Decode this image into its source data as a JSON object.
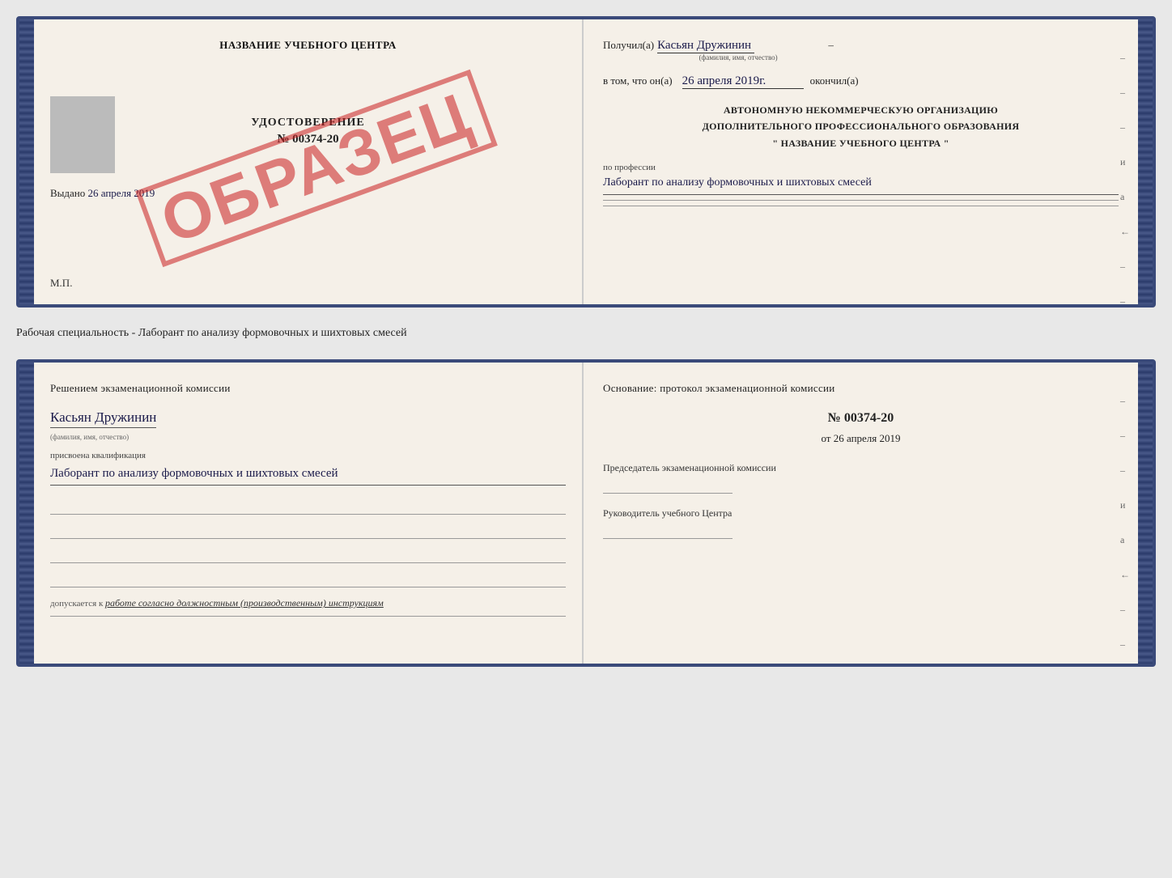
{
  "top_cert": {
    "left": {
      "title": "НАЗВАНИЕ УЧЕБНОГО ЦЕНТРА",
      "stamp": "ОБРАЗЕЦ",
      "udostoverenie_label": "УДОСТОВЕРЕНИЕ",
      "number": "№ 00374-20",
      "vydano_label": "Выдано",
      "vydano_date": "26 апреля 2019",
      "mp_label": "М.П."
    },
    "right": {
      "poluchil_label": "Получил(a)",
      "name_handwritten": "Касьян Дружинин",
      "name_subtext": "(фамилия, имя, отчество)",
      "vtom_label": "в том, что он(а)",
      "date_handwritten": "26 апреля 2019г.",
      "okonchil_label": "окончил(а)",
      "org_line1": "АВТОНОМНУЮ НЕКОММЕРЧЕСКУЮ ОРГАНИЗАЦИЮ",
      "org_line2": "ДОПОЛНИТЕЛЬНОГО ПРОФЕССИОНАЛЬНОГО ОБРАЗОВАНИЯ",
      "org_line3": "\"  НАЗВАНИЕ УЧЕБНОГО ЦЕНТРА  \"",
      "po_professii_label": "по профессии",
      "profession_handwritten": "Лаборант по анализу формовочных и шихтовых смесей",
      "dashes": [
        "-",
        "-",
        "-",
        "и",
        "а",
        "←",
        "-",
        "-",
        "-"
      ]
    }
  },
  "specialty_line": "Рабочая специальность - Лаборант по анализу формовочных и шихтовых смесей",
  "lower_cert": {
    "left": {
      "resheniem_label": "Решением экзаменационной комиссии",
      "name_handwritten": "Касьян Дружинин",
      "name_subtext": "(фамилия, имя, отчество)",
      "prisvoena_label": "присвоена квалификация",
      "kvalf_handwritten": "Лаборант по анализу формовочных и шихтовых смесей",
      "dopusk_label": "допускается к",
      "dopusk_text": "работе согласно должностным (производственным) инструкциям"
    },
    "right": {
      "osnov_label": "Основание: протокол экзаменационной комиссии",
      "protocol_number": "№ 00374-20",
      "ot_label": "от",
      "date": "26 апреля 2019",
      "predsedatel_label": "Председатель экзаменационной комиссии",
      "rukovoditel_label": "Руководитель учебного Центра",
      "dashes": [
        "-",
        "-",
        "-",
        "и",
        "а",
        "←",
        "-",
        "-"
      ]
    }
  }
}
